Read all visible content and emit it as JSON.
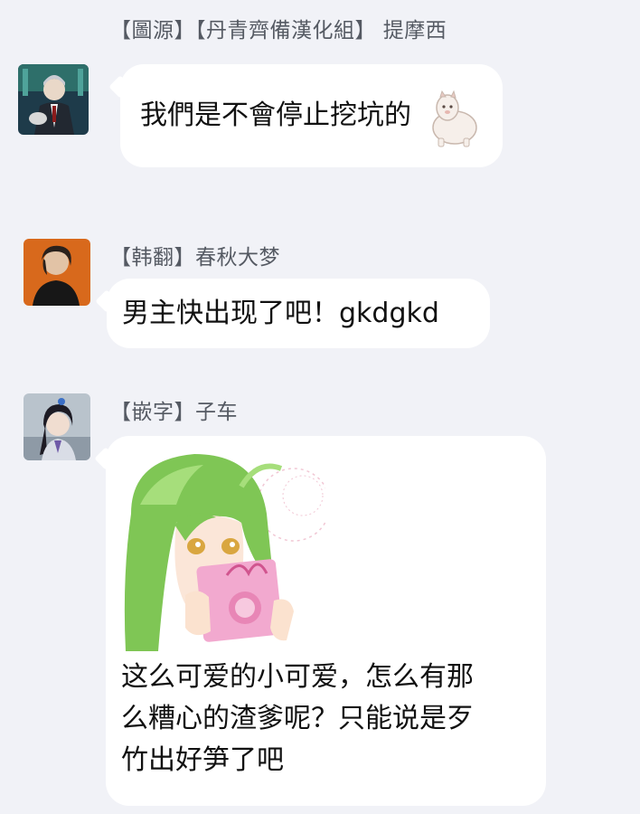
{
  "messages": [
    {
      "sender": "【圖源】【丹青齊備漢化組】 提摩西",
      "text": "我們是不會停止挖坑的",
      "avatar_icon": "avatar-dark-suit-man",
      "sticker_icon": "alpaca-sticker-icon"
    },
    {
      "sender": "【韩翻】春秋大梦",
      "text": "男主快出现了吧！gkdgkd",
      "avatar_icon": "avatar-orange-background-man"
    },
    {
      "sender": "【嵌字】子车",
      "text_lines": [
        "这么可爱的小可爱，怎么有那",
        "么糟心的渣爹呢？只能说是歹",
        "竹出好笋了吧"
      ],
      "avatar_icon": "avatar-ancient-style-character",
      "image_icon": "green-hair-girl-gift-sticker"
    }
  ],
  "colors": {
    "background": "#f1f2f7",
    "bubble": "#ffffff",
    "sender_text": "#555a63",
    "message_text": "#111111"
  }
}
